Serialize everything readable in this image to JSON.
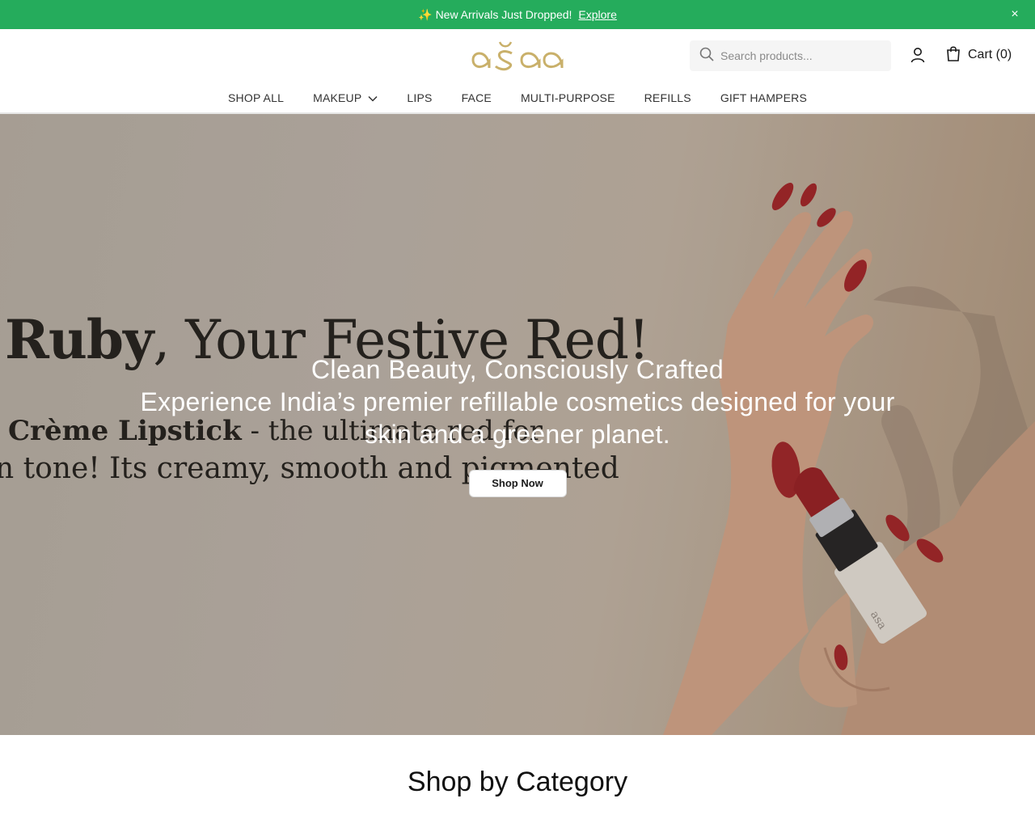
{
  "announcement": {
    "emoji": "✨",
    "text": "New Arrivals Just Dropped!",
    "link_label": "Explore",
    "close_label": "×",
    "bg_color": "#25ac5c"
  },
  "header": {
    "logo_alt": "asa",
    "search_placeholder": "Search products...",
    "cart_label": "Cart (0)"
  },
  "nav": {
    "items": [
      {
        "label": "SHOP ALL"
      },
      {
        "label": "MAKEUP",
        "has_dropdown": true
      },
      {
        "label": "LIPS"
      },
      {
        "label": "FACE"
      },
      {
        "label": "MULTI-PURPOSE"
      },
      {
        "label": "REFILLS"
      },
      {
        "label": "GIFT HAMPERS"
      }
    ]
  },
  "hero": {
    "bg_line1_bold": "Ruby",
    "bg_line1_rest": ", Your Festive Red!",
    "bg_line2_bold": "Crème Lipstick",
    "bg_line2_rest": " - the ultimate red for",
    "bg_line3": "n tone! Its creamy, smooth and pigmented",
    "title": "Clean Beauty, Consciously Crafted",
    "subtitle": "Experience India’s premier refillable cosmetics designed for your skin and a greener planet.",
    "cta_label": "Shop Now"
  },
  "category_section": {
    "title": "Shop by Category"
  },
  "icons": {
    "search": "search-icon",
    "user": "user-icon",
    "cart": "shopping-bag-icon",
    "dropdown": "chevron-down-icon",
    "close": "close-icon"
  }
}
